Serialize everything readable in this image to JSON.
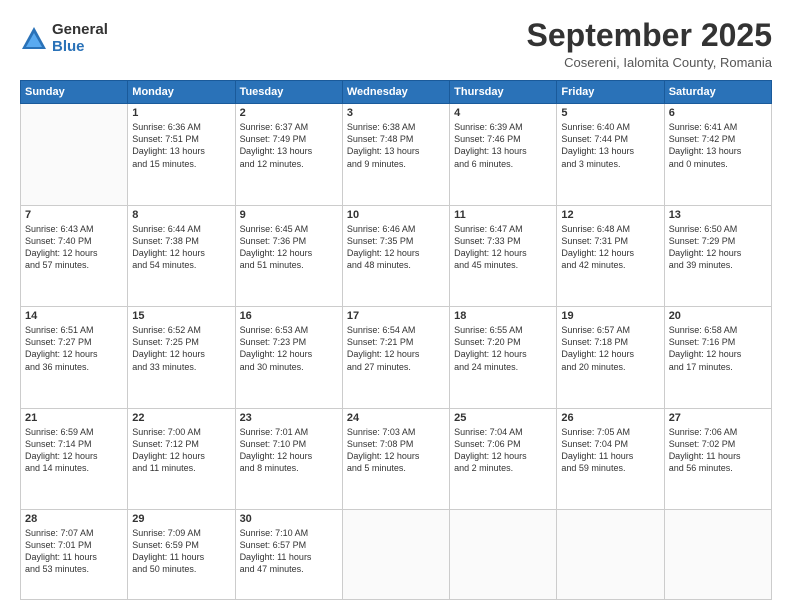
{
  "header": {
    "logo": {
      "general": "General",
      "blue": "Blue"
    },
    "title": "September 2025",
    "subtitle": "Cosereni, Ialomita County, Romania"
  },
  "days": [
    "Sunday",
    "Monday",
    "Tuesday",
    "Wednesday",
    "Thursday",
    "Friday",
    "Saturday"
  ],
  "weeks": [
    [
      {
        "day": "",
        "content": ""
      },
      {
        "day": "1",
        "content": "Sunrise: 6:36 AM\nSunset: 7:51 PM\nDaylight: 13 hours\nand 15 minutes."
      },
      {
        "day": "2",
        "content": "Sunrise: 6:37 AM\nSunset: 7:49 PM\nDaylight: 13 hours\nand 12 minutes."
      },
      {
        "day": "3",
        "content": "Sunrise: 6:38 AM\nSunset: 7:48 PM\nDaylight: 13 hours\nand 9 minutes."
      },
      {
        "day": "4",
        "content": "Sunrise: 6:39 AM\nSunset: 7:46 PM\nDaylight: 13 hours\nand 6 minutes."
      },
      {
        "day": "5",
        "content": "Sunrise: 6:40 AM\nSunset: 7:44 PM\nDaylight: 13 hours\nand 3 minutes."
      },
      {
        "day": "6",
        "content": "Sunrise: 6:41 AM\nSunset: 7:42 PM\nDaylight: 13 hours\nand 0 minutes."
      }
    ],
    [
      {
        "day": "7",
        "content": "Sunrise: 6:43 AM\nSunset: 7:40 PM\nDaylight: 12 hours\nand 57 minutes."
      },
      {
        "day": "8",
        "content": "Sunrise: 6:44 AM\nSunset: 7:38 PM\nDaylight: 12 hours\nand 54 minutes."
      },
      {
        "day": "9",
        "content": "Sunrise: 6:45 AM\nSunset: 7:36 PM\nDaylight: 12 hours\nand 51 minutes."
      },
      {
        "day": "10",
        "content": "Sunrise: 6:46 AM\nSunset: 7:35 PM\nDaylight: 12 hours\nand 48 minutes."
      },
      {
        "day": "11",
        "content": "Sunrise: 6:47 AM\nSunset: 7:33 PM\nDaylight: 12 hours\nand 45 minutes."
      },
      {
        "day": "12",
        "content": "Sunrise: 6:48 AM\nSunset: 7:31 PM\nDaylight: 12 hours\nand 42 minutes."
      },
      {
        "day": "13",
        "content": "Sunrise: 6:50 AM\nSunset: 7:29 PM\nDaylight: 12 hours\nand 39 minutes."
      }
    ],
    [
      {
        "day": "14",
        "content": "Sunrise: 6:51 AM\nSunset: 7:27 PM\nDaylight: 12 hours\nand 36 minutes."
      },
      {
        "day": "15",
        "content": "Sunrise: 6:52 AM\nSunset: 7:25 PM\nDaylight: 12 hours\nand 33 minutes."
      },
      {
        "day": "16",
        "content": "Sunrise: 6:53 AM\nSunset: 7:23 PM\nDaylight: 12 hours\nand 30 minutes."
      },
      {
        "day": "17",
        "content": "Sunrise: 6:54 AM\nSunset: 7:21 PM\nDaylight: 12 hours\nand 27 minutes."
      },
      {
        "day": "18",
        "content": "Sunrise: 6:55 AM\nSunset: 7:20 PM\nDaylight: 12 hours\nand 24 minutes."
      },
      {
        "day": "19",
        "content": "Sunrise: 6:57 AM\nSunset: 7:18 PM\nDaylight: 12 hours\nand 20 minutes."
      },
      {
        "day": "20",
        "content": "Sunrise: 6:58 AM\nSunset: 7:16 PM\nDaylight: 12 hours\nand 17 minutes."
      }
    ],
    [
      {
        "day": "21",
        "content": "Sunrise: 6:59 AM\nSunset: 7:14 PM\nDaylight: 12 hours\nand 14 minutes."
      },
      {
        "day": "22",
        "content": "Sunrise: 7:00 AM\nSunset: 7:12 PM\nDaylight: 12 hours\nand 11 minutes."
      },
      {
        "day": "23",
        "content": "Sunrise: 7:01 AM\nSunset: 7:10 PM\nDaylight: 12 hours\nand 8 minutes."
      },
      {
        "day": "24",
        "content": "Sunrise: 7:03 AM\nSunset: 7:08 PM\nDaylight: 12 hours\nand 5 minutes."
      },
      {
        "day": "25",
        "content": "Sunrise: 7:04 AM\nSunset: 7:06 PM\nDaylight: 12 hours\nand 2 minutes."
      },
      {
        "day": "26",
        "content": "Sunrise: 7:05 AM\nSunset: 7:04 PM\nDaylight: 11 hours\nand 59 minutes."
      },
      {
        "day": "27",
        "content": "Sunrise: 7:06 AM\nSunset: 7:02 PM\nDaylight: 11 hours\nand 56 minutes."
      }
    ],
    [
      {
        "day": "28",
        "content": "Sunrise: 7:07 AM\nSunset: 7:01 PM\nDaylight: 11 hours\nand 53 minutes."
      },
      {
        "day": "29",
        "content": "Sunrise: 7:09 AM\nSunset: 6:59 PM\nDaylight: 11 hours\nand 50 minutes."
      },
      {
        "day": "30",
        "content": "Sunrise: 7:10 AM\nSunset: 6:57 PM\nDaylight: 11 hours\nand 47 minutes."
      },
      {
        "day": "",
        "content": ""
      },
      {
        "day": "",
        "content": ""
      },
      {
        "day": "",
        "content": ""
      },
      {
        "day": "",
        "content": ""
      }
    ]
  ]
}
